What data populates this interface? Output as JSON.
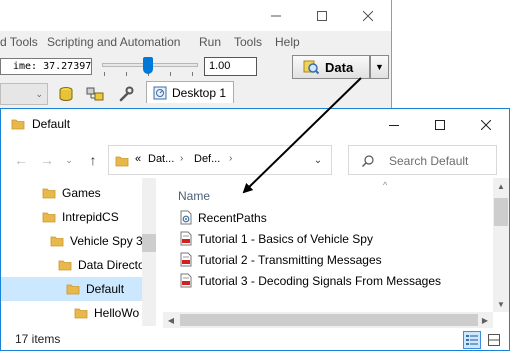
{
  "background_app": {
    "menu": [
      "d Tools",
      "Scripting and Automation",
      "Run",
      "Tools",
      "Help"
    ],
    "time_readout": "ime: 37.27397",
    "zoom_value": "1.00",
    "data_button_label": "Data",
    "desktop_tab_label": "Desktop 1",
    "colors": {
      "time_led": "#00e000",
      "slider_thumb": "#0078d7"
    }
  },
  "explorer": {
    "title": "Default",
    "breadcrumb": [
      "«",
      "Dat...",
      "Def..."
    ],
    "search_placeholder": "Search Default",
    "nav_tree": [
      {
        "label": "Games",
        "indent": 1,
        "selected": false
      },
      {
        "label": "IntrepidCS",
        "indent": 1,
        "selected": false
      },
      {
        "label": "Vehicle Spy 3",
        "indent": 2,
        "selected": false
      },
      {
        "label": "Data Directo",
        "indent": 3,
        "selected": false
      },
      {
        "label": "Default",
        "indent": 4,
        "selected": true
      },
      {
        "label": "HelloWo",
        "indent": 5,
        "selected": false
      }
    ],
    "column_header": "Name",
    "files": [
      {
        "name": "RecentPaths",
        "icon": "config-file-icon"
      },
      {
        "name": "Tutorial 1 - Basics of Vehicle Spy",
        "icon": "vs3-file-icon"
      },
      {
        "name": "Tutorial 2 - Transmitting Messages",
        "icon": "vs3-file-icon"
      },
      {
        "name": "Tutorial 3 - Decoding Signals From Messages",
        "icon": "vs3-file-icon"
      }
    ],
    "status_text": "17 items",
    "colors": {
      "accent": "#1883d7",
      "selection": "#cce8ff",
      "folder": "#e8b84a"
    }
  }
}
